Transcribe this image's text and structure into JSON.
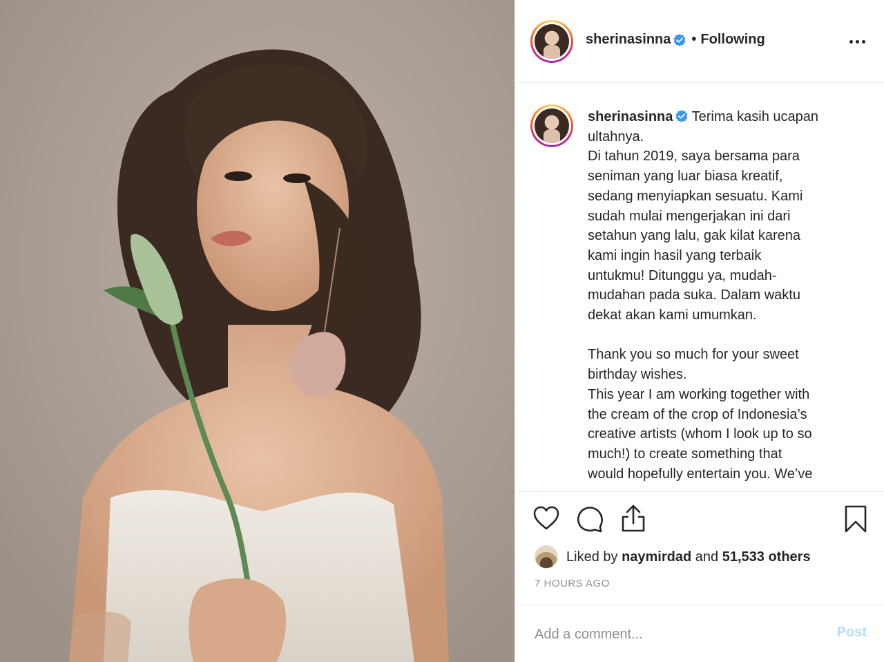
{
  "post": {
    "author": {
      "username": "sherinasinna",
      "verified": true,
      "separator": "•",
      "follow_status": "Following"
    },
    "more_options_icon": "more-horizontal-icon",
    "caption": {
      "username": "sherinasinna",
      "text": " Terima kasih ucapan\nultahnya.\nDi tahun 2019, saya bersama para\nseniman yang luar biasa kreatif,\nsedang menyiapkan sesuatu. Kami\nsudah mulai mengerjakan ini dari\nsetahun yang lalu, gak kilat karena\nkami ingin hasil yang terbaik\nuntukmu! Ditunggu ya, mudah-\nmudahan pada suka. Dalam waktu\ndekat akan kami umumkan.\n\nThank you so much for your sweet\nbirthday wishes.\nThis year I am working together with\nthe cream of the crop of Indonesia’s\ncreative artists (whom I look up to so\nmuch!) to create something that\nwould hopefully entertain you. We’ve"
    },
    "actions": {
      "like_icon": "heart-icon",
      "comment_icon": "comment-icon",
      "share_icon": "share-icon",
      "save_icon": "bookmark-icon"
    },
    "likes": {
      "prefix": "Liked by",
      "user": "naymirdad",
      "middle": "and",
      "others": "51,533 others"
    },
    "timestamp": "7 HOURS AGO",
    "comment": {
      "placeholder": "Add a comment...",
      "post_label": "Post"
    },
    "colors": {
      "verified_blue": "#3897f0",
      "post_button_disabled": "#b2dffc",
      "muted_text": "#8e8e8e"
    }
  }
}
